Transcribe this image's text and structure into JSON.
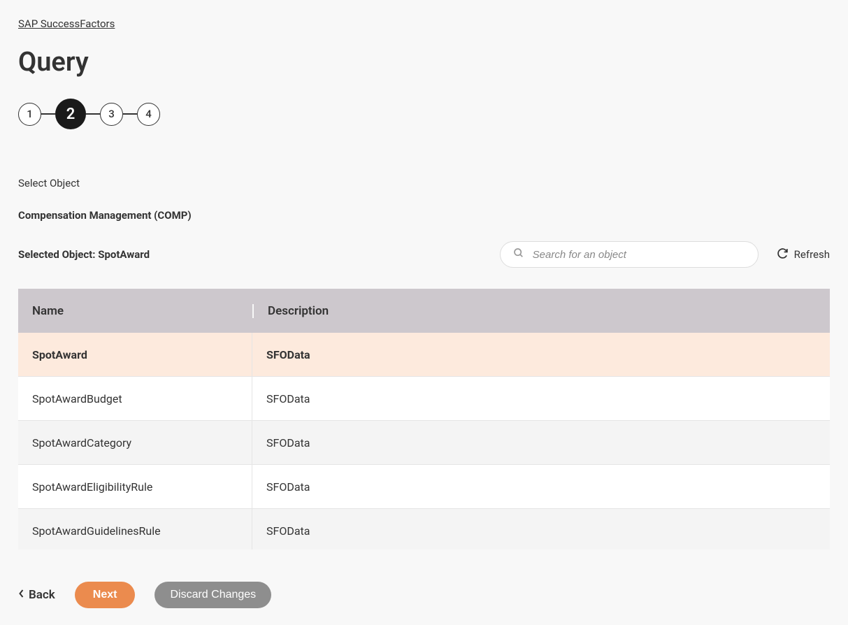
{
  "breadcrumb": {
    "label": "SAP SuccessFactors"
  },
  "page": {
    "title": "Query"
  },
  "stepper": {
    "steps": [
      "1",
      "2",
      "3",
      "4"
    ],
    "active_index": 1
  },
  "section": {
    "label": "Select Object",
    "module": "Compensation Management (COMP)",
    "selected_prefix": "Selected Object: ",
    "selected_value": "SpotAward"
  },
  "search": {
    "placeholder": "Search for an object"
  },
  "refresh": {
    "label": "Refresh"
  },
  "table": {
    "headers": {
      "name": "Name",
      "description": "Description"
    },
    "rows": [
      {
        "name": "SpotAward",
        "description": "SFOData",
        "selected": true
      },
      {
        "name": "SpotAwardBudget",
        "description": "SFOData",
        "selected": false
      },
      {
        "name": "SpotAwardCategory",
        "description": "SFOData",
        "selected": false
      },
      {
        "name": "SpotAwardEligibilityRule",
        "description": "SFOData",
        "selected": false
      },
      {
        "name": "SpotAwardGuidelinesRule",
        "description": "SFOData",
        "selected": false
      }
    ]
  },
  "footer": {
    "back": "Back",
    "next": "Next",
    "discard": "Discard Changes"
  }
}
